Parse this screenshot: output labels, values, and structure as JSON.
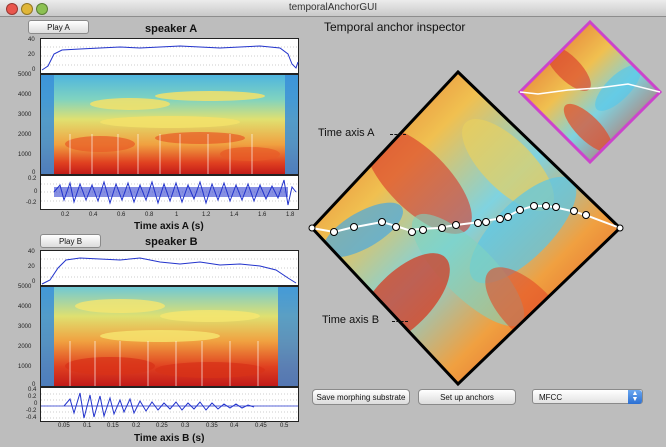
{
  "window": {
    "title": "temporalAnchorGUI"
  },
  "speakerA": {
    "play_label": "Play A",
    "title": "speaker A",
    "xaxis_label": "Time axis A (s)",
    "pitch_ticks": [
      "40",
      "20",
      "0"
    ],
    "spec_ticks": [
      "5000",
      "4000",
      "3000",
      "2000",
      "1000",
      "0"
    ],
    "wave_ticks": [
      "0.2",
      "0",
      "-0.2"
    ],
    "time_ticks": [
      "0.2",
      "0.4",
      "0.6",
      "0.8",
      "1",
      "1.2",
      "1.4",
      "1.6",
      "1.8"
    ]
  },
  "speakerB": {
    "play_label": "Play B",
    "title": "speaker B",
    "xaxis_label": "Time axis B (s)",
    "pitch_ticks": [
      "40",
      "20",
      "0"
    ],
    "spec_ticks": [
      "5000",
      "4000",
      "3000",
      "2000",
      "1000",
      "0"
    ],
    "wave_ticks": [
      "0.4",
      "0.2",
      "0",
      "-0.2",
      "-0.4"
    ],
    "time_ticks": [
      "0.05",
      "0.1",
      "0.15",
      "0.2",
      "0.25",
      "0.3",
      "0.35",
      "0.4",
      "0.45",
      "0.5"
    ]
  },
  "inspector": {
    "title": "Temporal anchor inspector",
    "axis_a_label": "Time axis A",
    "axis_b_label": "Time axis B"
  },
  "buttons": {
    "save_label": "Save morphing substrate",
    "anchors_label": "Set up anchors"
  },
  "feature_select": {
    "value": "MFCC"
  },
  "colors": {
    "background": "#bdbdbd",
    "selection_frame": "#cc44cc",
    "waveform": "#2233cc"
  }
}
